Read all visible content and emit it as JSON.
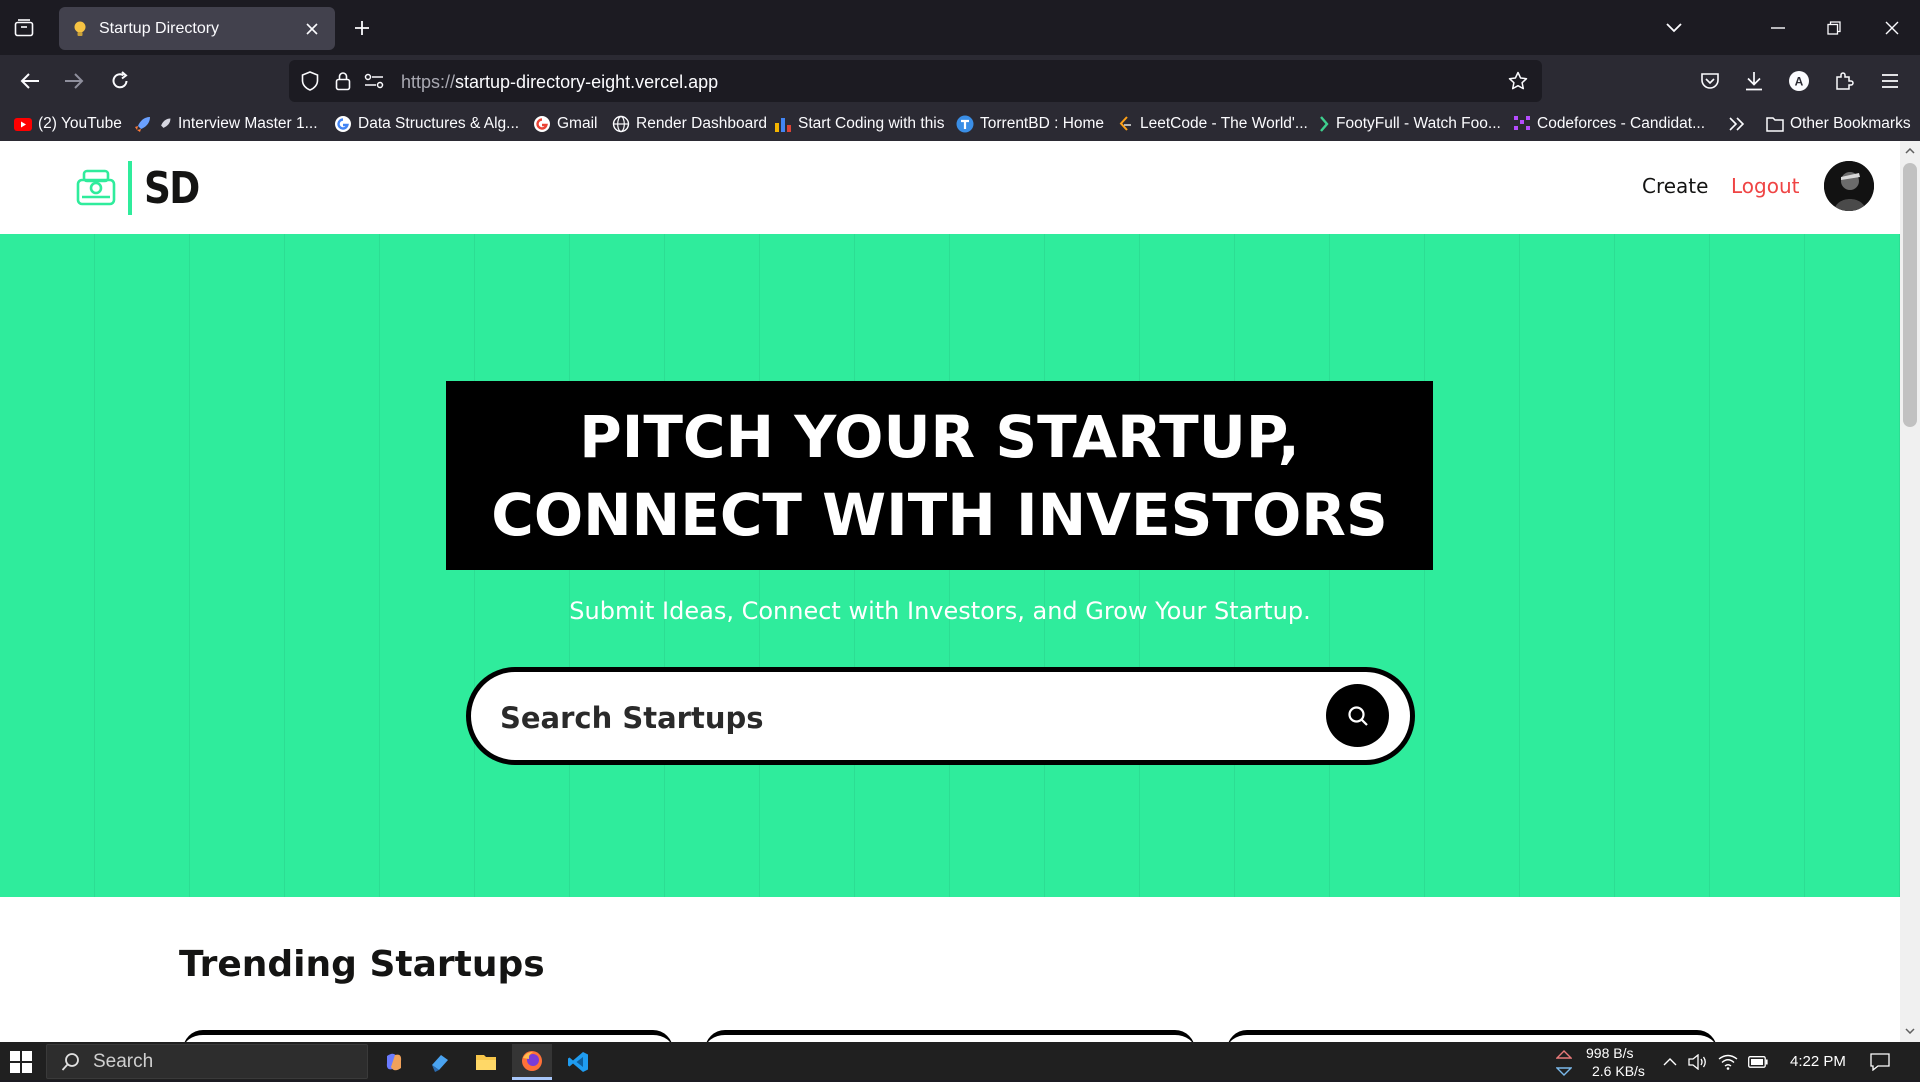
{
  "browser": {
    "tab_title": "Startup Directory",
    "url_scheme": "https://",
    "url_host": "startup-directory-eight.vercel.app"
  },
  "bookmarks": [
    {
      "label": "(2) YouTube",
      "icon": "youtube-icon"
    },
    {
      "label": "Interview Master 1...",
      "icon": "rocket-icon"
    },
    {
      "label": "Data Structures & Alg...",
      "icon": "google-icon"
    },
    {
      "label": "Gmail",
      "icon": "google-icon"
    },
    {
      "label": "Render Dashboard",
      "icon": "globe-icon"
    },
    {
      "label": "Start Coding with this",
      "icon": "bar-chart-icon"
    },
    {
      "label": "TorrentBD : Home",
      "icon": "torrentbd-icon"
    },
    {
      "label": "LeetCode - The World'...",
      "icon": "leetcode-icon"
    },
    {
      "label": "FootyFull - Watch Foo...",
      "icon": "footyfull-icon"
    },
    {
      "label": "Codeforces - Candidat...",
      "icon": "codeforces-icon"
    }
  ],
  "bookmarks_other": "Other Bookmarks",
  "site": {
    "logo_text": "SD",
    "nav_create": "Create",
    "nav_logout": "Logout",
    "hero_line1": "PITCH YOUR STARTUP,",
    "hero_line2": "CONNECT WITH INVESTORS",
    "hero_subtitle": "Submit Ideas, Connect with Investors, and Grow Your Startup.",
    "search_placeholder": "Search Startups",
    "section_title": "Trending Startups",
    "accent_color": "#2fec9c",
    "logout_color": "#ef4444"
  },
  "taskbar": {
    "search_label": "Search",
    "net_up": "998 B/s",
    "net_down": "2.6 KB/s",
    "time": "4:22 PM"
  }
}
